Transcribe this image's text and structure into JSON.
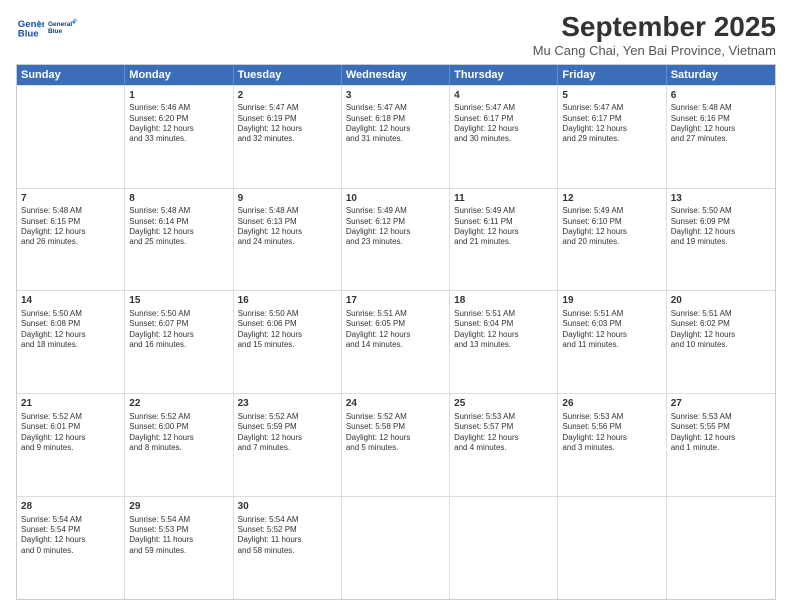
{
  "header": {
    "logo_line1": "General",
    "logo_line2": "Blue",
    "month": "September 2025",
    "location": "Mu Cang Chai, Yen Bai Province, Vietnam"
  },
  "weekdays": [
    "Sunday",
    "Monday",
    "Tuesday",
    "Wednesday",
    "Thursday",
    "Friday",
    "Saturday"
  ],
  "rows": [
    [
      {
        "day": "",
        "text": ""
      },
      {
        "day": "1",
        "text": "Sunrise: 5:46 AM\nSunset: 6:20 PM\nDaylight: 12 hours\nand 33 minutes."
      },
      {
        "day": "2",
        "text": "Sunrise: 5:47 AM\nSunset: 6:19 PM\nDaylight: 12 hours\nand 32 minutes."
      },
      {
        "day": "3",
        "text": "Sunrise: 5:47 AM\nSunset: 6:18 PM\nDaylight: 12 hours\nand 31 minutes."
      },
      {
        "day": "4",
        "text": "Sunrise: 5:47 AM\nSunset: 6:17 PM\nDaylight: 12 hours\nand 30 minutes."
      },
      {
        "day": "5",
        "text": "Sunrise: 5:47 AM\nSunset: 6:17 PM\nDaylight: 12 hours\nand 29 minutes."
      },
      {
        "day": "6",
        "text": "Sunrise: 5:48 AM\nSunset: 6:16 PM\nDaylight: 12 hours\nand 27 minutes."
      }
    ],
    [
      {
        "day": "7",
        "text": "Sunrise: 5:48 AM\nSunset: 6:15 PM\nDaylight: 12 hours\nand 26 minutes."
      },
      {
        "day": "8",
        "text": "Sunrise: 5:48 AM\nSunset: 6:14 PM\nDaylight: 12 hours\nand 25 minutes."
      },
      {
        "day": "9",
        "text": "Sunrise: 5:48 AM\nSunset: 6:13 PM\nDaylight: 12 hours\nand 24 minutes."
      },
      {
        "day": "10",
        "text": "Sunrise: 5:49 AM\nSunset: 6:12 PM\nDaylight: 12 hours\nand 23 minutes."
      },
      {
        "day": "11",
        "text": "Sunrise: 5:49 AM\nSunset: 6:11 PM\nDaylight: 12 hours\nand 21 minutes."
      },
      {
        "day": "12",
        "text": "Sunrise: 5:49 AM\nSunset: 6:10 PM\nDaylight: 12 hours\nand 20 minutes."
      },
      {
        "day": "13",
        "text": "Sunrise: 5:50 AM\nSunset: 6:09 PM\nDaylight: 12 hours\nand 19 minutes."
      }
    ],
    [
      {
        "day": "14",
        "text": "Sunrise: 5:50 AM\nSunset: 6:08 PM\nDaylight: 12 hours\nand 18 minutes."
      },
      {
        "day": "15",
        "text": "Sunrise: 5:50 AM\nSunset: 6:07 PM\nDaylight: 12 hours\nand 16 minutes."
      },
      {
        "day": "16",
        "text": "Sunrise: 5:50 AM\nSunset: 6:06 PM\nDaylight: 12 hours\nand 15 minutes."
      },
      {
        "day": "17",
        "text": "Sunrise: 5:51 AM\nSunset: 6:05 PM\nDaylight: 12 hours\nand 14 minutes."
      },
      {
        "day": "18",
        "text": "Sunrise: 5:51 AM\nSunset: 6:04 PM\nDaylight: 12 hours\nand 13 minutes."
      },
      {
        "day": "19",
        "text": "Sunrise: 5:51 AM\nSunset: 6:03 PM\nDaylight: 12 hours\nand 11 minutes."
      },
      {
        "day": "20",
        "text": "Sunrise: 5:51 AM\nSunset: 6:02 PM\nDaylight: 12 hours\nand 10 minutes."
      }
    ],
    [
      {
        "day": "21",
        "text": "Sunrise: 5:52 AM\nSunset: 6:01 PM\nDaylight: 12 hours\nand 9 minutes."
      },
      {
        "day": "22",
        "text": "Sunrise: 5:52 AM\nSunset: 6:00 PM\nDaylight: 12 hours\nand 8 minutes."
      },
      {
        "day": "23",
        "text": "Sunrise: 5:52 AM\nSunset: 5:59 PM\nDaylight: 12 hours\nand 7 minutes."
      },
      {
        "day": "24",
        "text": "Sunrise: 5:52 AM\nSunset: 5:58 PM\nDaylight: 12 hours\nand 5 minutes."
      },
      {
        "day": "25",
        "text": "Sunrise: 5:53 AM\nSunset: 5:57 PM\nDaylight: 12 hours\nand 4 minutes."
      },
      {
        "day": "26",
        "text": "Sunrise: 5:53 AM\nSunset: 5:56 PM\nDaylight: 12 hours\nand 3 minutes."
      },
      {
        "day": "27",
        "text": "Sunrise: 5:53 AM\nSunset: 5:55 PM\nDaylight: 12 hours\nand 1 minute."
      }
    ],
    [
      {
        "day": "28",
        "text": "Sunrise: 5:54 AM\nSunset: 5:54 PM\nDaylight: 12 hours\nand 0 minutes."
      },
      {
        "day": "29",
        "text": "Sunrise: 5:54 AM\nSunset: 5:53 PM\nDaylight: 11 hours\nand 59 minutes."
      },
      {
        "day": "30",
        "text": "Sunrise: 5:54 AM\nSunset: 5:52 PM\nDaylight: 11 hours\nand 58 minutes."
      },
      {
        "day": "",
        "text": ""
      },
      {
        "day": "",
        "text": ""
      },
      {
        "day": "",
        "text": ""
      },
      {
        "day": "",
        "text": ""
      }
    ]
  ]
}
